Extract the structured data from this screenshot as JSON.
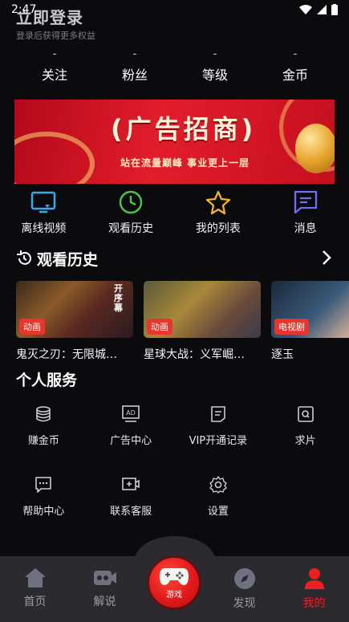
{
  "status": {
    "time": "2:47"
  },
  "login": {
    "title": "立即登录",
    "subtitle": "登录后获得更多权益"
  },
  "stats": [
    {
      "value": "-",
      "label": "关注"
    },
    {
      "value": "-",
      "label": "粉丝"
    },
    {
      "value": "-",
      "label": "等级"
    },
    {
      "value": "-",
      "label": "金币"
    }
  ],
  "banner": {
    "title": "(广告招商)",
    "subtitle": "站在流量巅峰  事业更上一层"
  },
  "quick": [
    {
      "label": "离线视频",
      "icon": "offline-video-icon",
      "color": "#39a8e8"
    },
    {
      "label": "观看历史",
      "icon": "history-clock-icon",
      "color": "#4fc04a"
    },
    {
      "label": "我的列表",
      "icon": "star-icon",
      "color": "#f0b42a"
    },
    {
      "label": "消息",
      "icon": "message-icon",
      "color": "#6d6ef0"
    }
  ],
  "history": {
    "title": "观看历史",
    "items": [
      {
        "title": "鬼灭之刃：无限城…",
        "tag": "动画",
        "overlay": "开序幕"
      },
      {
        "title": "星球大战：义军崛…",
        "tag": "动画"
      },
      {
        "title": "逐玉",
        "tag": "电视剧"
      }
    ]
  },
  "services": {
    "title": "个人服务",
    "items": [
      {
        "label": "赚金币",
        "icon": "coins-icon"
      },
      {
        "label": "广告中心",
        "icon": "ad-icon"
      },
      {
        "label": "VIP开通记录",
        "icon": "record-icon"
      },
      {
        "label": "求片",
        "icon": "request-icon"
      },
      {
        "label": "帮助中心",
        "icon": "help-chat-icon"
      },
      {
        "label": "联系客服",
        "icon": "contact-icon"
      },
      {
        "label": "设置",
        "icon": "gear-icon"
      }
    ]
  },
  "tabs": [
    {
      "label": "首页",
      "icon": "home-icon"
    },
    {
      "label": "解说",
      "icon": "commentary-icon"
    },
    {
      "label": "游戏",
      "icon": "gamepad-icon"
    },
    {
      "label": "发现",
      "icon": "discover-icon"
    },
    {
      "label": "我的",
      "icon": "user-icon",
      "active": true
    }
  ],
  "colors": {
    "accent": "#e8211f",
    "tag": "#e8362f",
    "background": "#0b0b0e"
  }
}
